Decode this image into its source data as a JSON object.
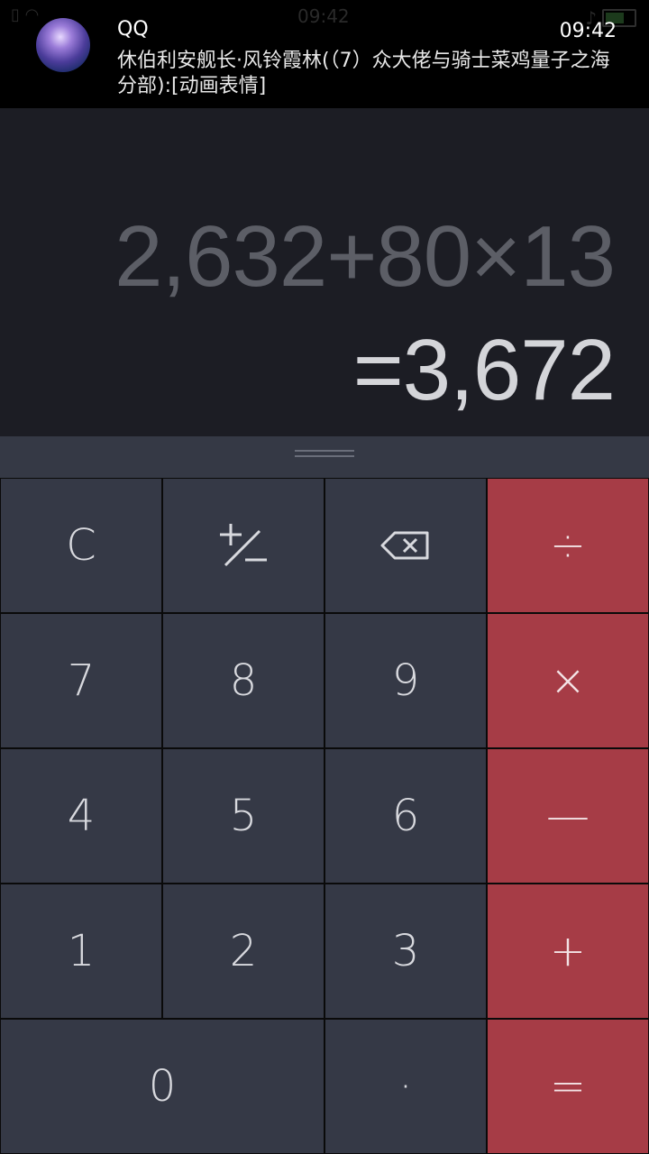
{
  "notification": {
    "app": "QQ",
    "time": "09:42",
    "message": "休伯利安舰长·风铃霞林(（7）众大佬与骑士菜鸡量子之海分部):[动画表情]",
    "avatar_icon": "qq-avatar"
  },
  "status_bar": {
    "time": "09:42",
    "left_icons": [
      "sim-icon",
      "wifi-icon"
    ],
    "right_icons": [
      "mute-icon",
      "moon-icon",
      "battery-icon"
    ]
  },
  "display": {
    "expression": "2,632+80×13",
    "result": "=3,672"
  },
  "keypad": {
    "clear": "C",
    "plus_minus": "+/−",
    "backspace_icon": "backspace-icon",
    "divide": "÷",
    "seven": "7",
    "eight": "8",
    "nine": "9",
    "multiply": "×",
    "four": "4",
    "five": "5",
    "six": "6",
    "minus": "—",
    "one": "1",
    "two": "2",
    "three": "3",
    "plus": "+",
    "zero": "0",
    "decimal": "·",
    "equals": "="
  },
  "colors": {
    "display_bg": "#1c1d24",
    "key_bg": "#353946",
    "operator_bg": "#a63c46",
    "expression_text": "#5c5e66",
    "result_text": "#d4d5d9"
  }
}
